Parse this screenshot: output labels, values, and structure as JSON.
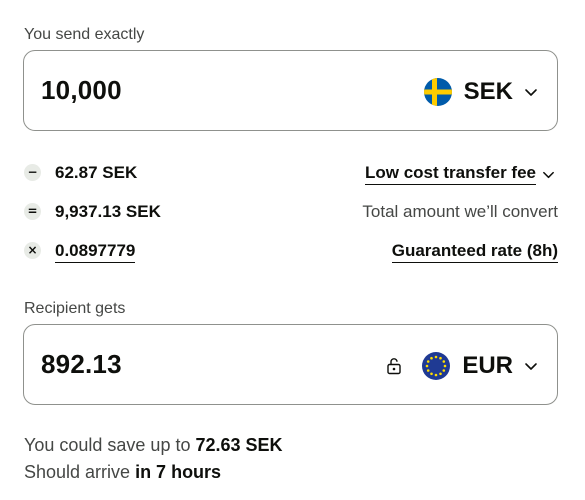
{
  "send": {
    "label": "You send exactly",
    "amount": "10,000",
    "currency": "SEK",
    "flag_icon": "sweden-flag-icon"
  },
  "breakdown": {
    "fee_value": "62.87 SEK",
    "fee_link": "Low cost transfer fee",
    "convert_value": "9,937.13 SEK",
    "convert_label": "Total amount we’ll convert",
    "rate_value": "0.0897779",
    "rate_link": "Guaranteed rate (8h)",
    "icons": {
      "minus": "−",
      "equals": "=",
      "times": "×"
    }
  },
  "recipient": {
    "label": "Recipient gets",
    "amount": "892.13",
    "currency": "EUR",
    "flag_icon": "eu-flag-icon"
  },
  "summary": {
    "save_prefix": "You could save up to ",
    "save_amount": "72.63 SEK",
    "arrive_prefix": "Should arrive ",
    "arrive_time": "in 7 hours"
  },
  "colors": {
    "text": "#0e0f0c",
    "muted": "#454745",
    "border": "#8f918d",
    "icon_bg": "#e8ebe6",
    "sweden_blue": "#005baa",
    "sweden_yellow": "#fecc00",
    "eu_blue": "#1f3a93",
    "eu_star": "#ffdd00"
  }
}
